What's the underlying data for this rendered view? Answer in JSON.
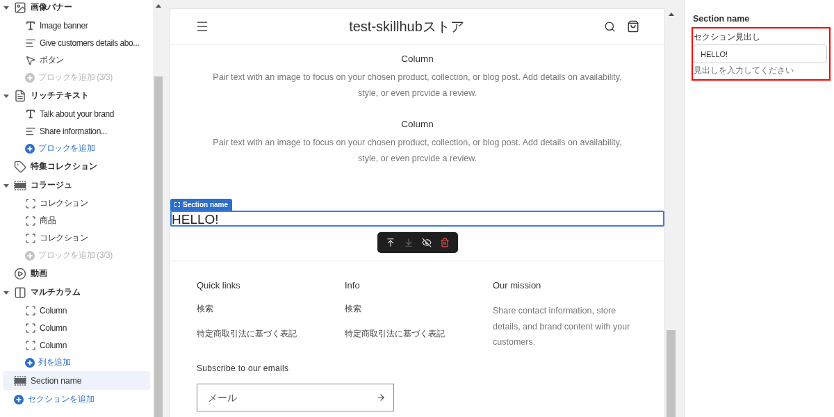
{
  "sidebar": {
    "items": [
      {
        "label": "画像バナー",
        "kind": "image",
        "expanded": true,
        "selected": false,
        "children": [
          {
            "label": "Image banner",
            "kind": "text",
            "selected": false
          },
          {
            "label": "Give customers details abo...",
            "kind": "paragraph",
            "selected": false
          },
          {
            "label": "ボタン",
            "kind": "button",
            "selected": false
          },
          {
            "label": "ブロックを追加 (3/3)",
            "kind": "add",
            "disabled": true
          }
        ]
      },
      {
        "label": "リッチテキスト",
        "kind": "richtext",
        "expanded": true,
        "selected": false,
        "children": [
          {
            "label": "Talk about your brand",
            "kind": "text",
            "selected": false
          },
          {
            "label": "Share information...",
            "kind": "paragraph",
            "selected": false
          },
          {
            "label": "ブロックを追加",
            "kind": "add",
            "disabled": false
          }
        ]
      },
      {
        "label": "特集コレクション",
        "kind": "collection",
        "selected": false
      },
      {
        "label": "コラージュ",
        "kind": "collage",
        "expanded": true,
        "selected": false,
        "children": [
          {
            "label": "コレクション",
            "kind": "block",
            "selected": false
          },
          {
            "label": "商品",
            "kind": "block",
            "selected": false
          },
          {
            "label": "コレクション",
            "kind": "block",
            "selected": false
          },
          {
            "label": "ブロックを追加 (3/3)",
            "kind": "add",
            "disabled": true
          }
        ]
      },
      {
        "label": "動画",
        "kind": "video",
        "selected": false
      },
      {
        "label": "マルチカラム",
        "kind": "multicolumn",
        "expanded": true,
        "selected": false,
        "children": [
          {
            "label": "Column",
            "kind": "block",
            "selected": false
          },
          {
            "label": "Column",
            "kind": "block",
            "selected": false
          },
          {
            "label": "Column",
            "kind": "block",
            "selected": false
          },
          {
            "label": "列を追加",
            "kind": "add",
            "disabled": false
          }
        ]
      },
      {
        "label": "Section name",
        "kind": "section",
        "selected": true
      },
      {
        "label": "セクションを追加",
        "kind": "add",
        "disabled": false
      }
    ]
  },
  "preview": {
    "header": {
      "store_name": "test-skillhubストア"
    },
    "columns": [
      {
        "title": "Column",
        "text": "Pair text with an image to focus on your chosen product, collection, or blog post. Add details on availability, style, or even prcvide a review."
      },
      {
        "title": "Column",
        "text": "Pair text with an image to focus on your chosen product, collection, or blog post. Add details on availability, style, or even prcvide a review."
      }
    ],
    "section": {
      "tag": "Section name",
      "heading": "HELLO!",
      "selected": true
    },
    "toolbar": [
      {
        "kind": "move-up",
        "disabled": false
      },
      {
        "kind": "move-down",
        "disabled": true
      },
      {
        "kind": "hide",
        "disabled": false
      },
      {
        "kind": "delete",
        "disabled": false
      }
    ],
    "footer": {
      "columns": [
        {
          "heading": "Quick links",
          "links": [
            "検索",
            "特定商取引法に基づく表記"
          ]
        },
        {
          "heading": "Info",
          "links": [
            "検索",
            "特定商取引法に基づく表記"
          ]
        },
        {
          "heading": "Our mission",
          "text": "Share contact information, store details, and brand content with your customers."
        }
      ],
      "subscribe": {
        "heading": "Subscribe to our emails",
        "placeholder": "メール"
      }
    }
  },
  "settings": {
    "title": "Section name",
    "field": {
      "label": "セクション見出し",
      "value": "HELLO!",
      "hint": "見出しを入力してください",
      "highlighted": true
    }
  }
}
